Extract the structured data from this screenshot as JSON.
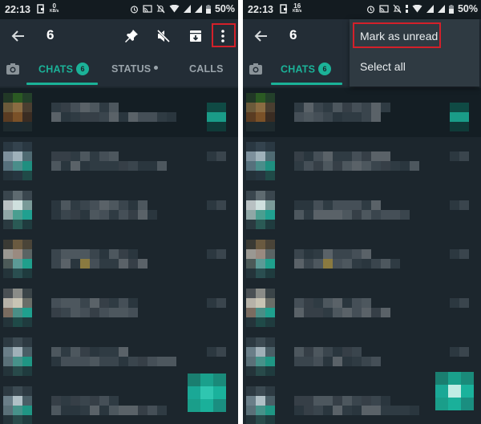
{
  "panels": [
    {
      "id": "left",
      "status_bar": {
        "time": "22:13",
        "speed_value": "0",
        "speed_unit": "KB/s",
        "battery": "50%"
      },
      "app_bar": {
        "selected_count": "6",
        "icons": [
          "back-arrow-icon",
          "pin-icon",
          "mute-icon",
          "archive-icon",
          "more-vert-icon"
        ],
        "highlighted": "more-vert-icon"
      },
      "tabs": [
        {
          "label": "CHATS",
          "badge": "6",
          "active": true
        },
        {
          "label": "STATUS",
          "dot": true,
          "active": false
        },
        {
          "label": "CALLS",
          "active": false
        }
      ]
    },
    {
      "id": "right",
      "status_bar": {
        "time": "22:13",
        "speed_value": "16",
        "speed_unit": "KB/s",
        "battery": "50%"
      },
      "app_bar": {
        "selected_count": "6"
      },
      "tabs": [
        {
          "label": "CHATS",
          "badge": "6",
          "active": true
        }
      ],
      "overflow_menu": {
        "items": [
          {
            "label": "Mark as unread",
            "highlighted": true
          },
          {
            "label": "Select all",
            "highlighted": false
          }
        ]
      }
    }
  ],
  "chat_list": {
    "blurred": true,
    "row_count": 7,
    "selected_rows": [
      0
    ]
  },
  "colors": {
    "accent": "#1bb298",
    "background": "#1c262d",
    "app_bar": "#232d36",
    "highlight_box": "#d4202a"
  }
}
